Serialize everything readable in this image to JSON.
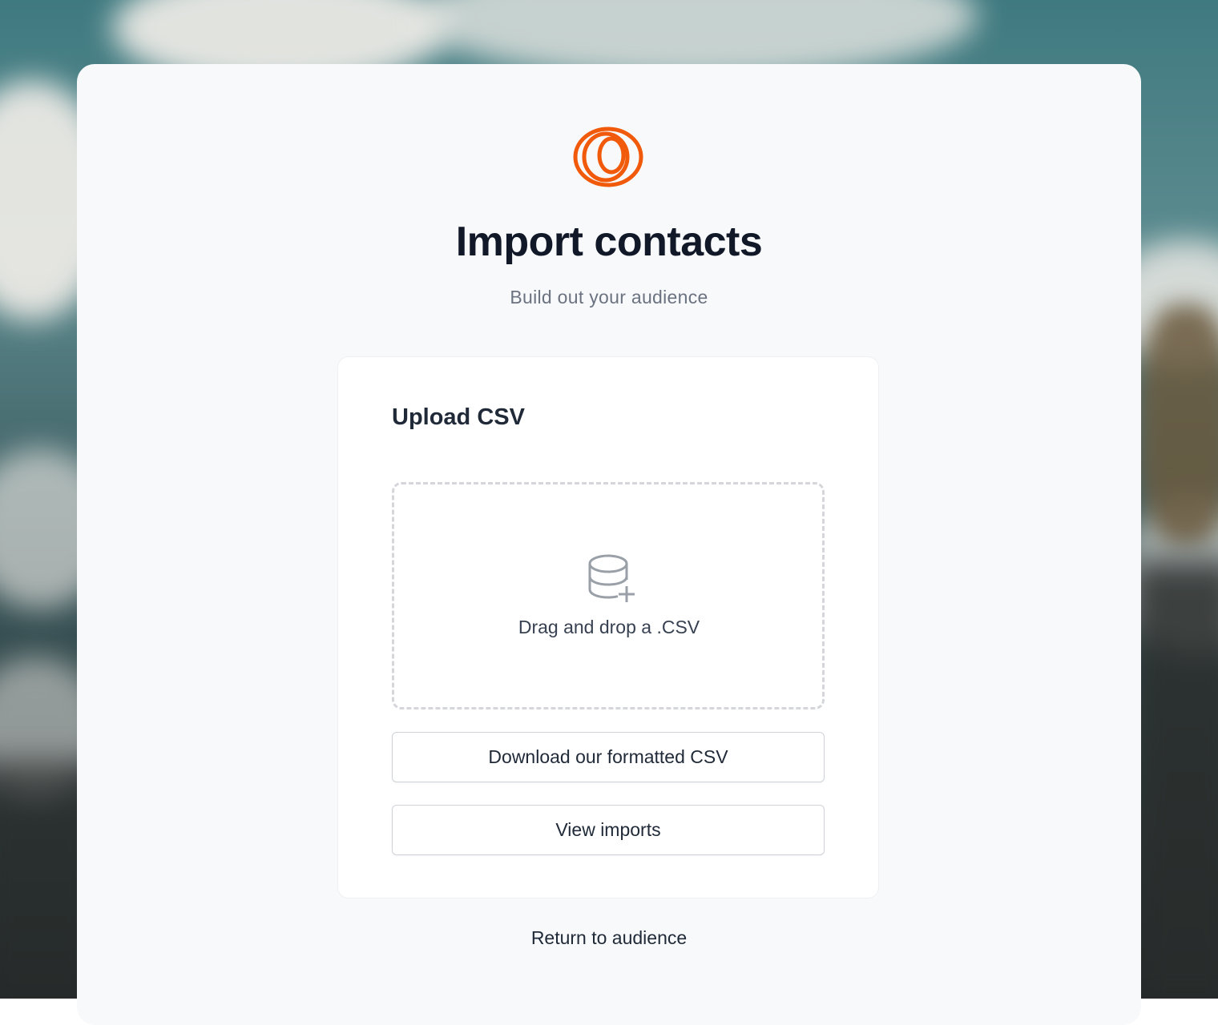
{
  "header": {
    "logo_icon": "concentric-rings-logo",
    "title": "Import contacts",
    "subtitle": "Build out your audience"
  },
  "upload_card": {
    "heading": "Upload CSV",
    "dropzone": {
      "icon": "database-plus-icon",
      "label": "Drag and drop a .CSV"
    },
    "download_button_label": "Download our formatted CSV",
    "view_imports_button_label": "View imports"
  },
  "footer": {
    "return_link_label": "Return to audience"
  },
  "colors": {
    "brand_orange": "#f15a0a",
    "panel_background": "#f8f9fb",
    "title_text": "#111827",
    "muted_text": "#6b7280"
  }
}
